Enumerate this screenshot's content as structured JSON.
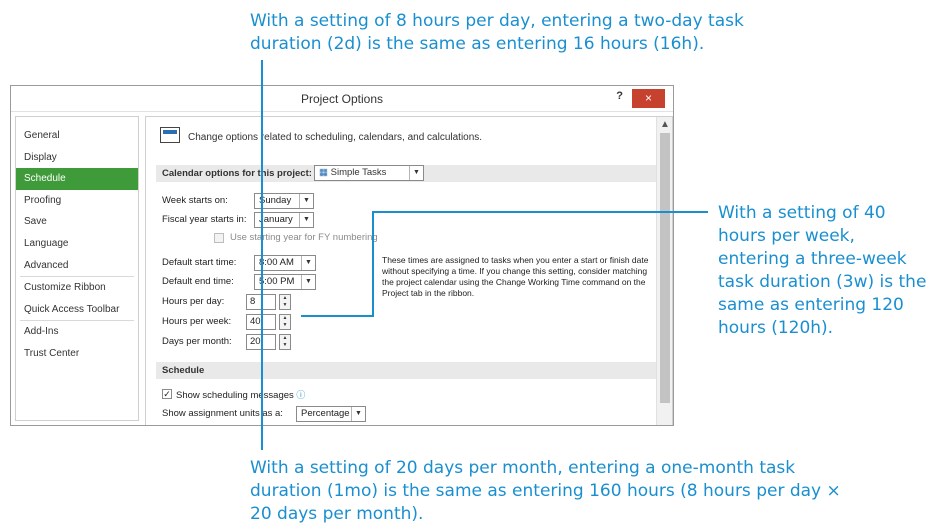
{
  "callouts": {
    "top": "With a setting of 8 hours per day, entering a two-day task duration (2d) is the same as entering 16 hours (16h).",
    "right": "With a setting of 40 hours per week, entering a three-week task duration (3w) is the same as entering 120 hours (120h).",
    "bottom": "With a setting of 20 days per month, entering a one-month task duration (1mo) is the same as entering 160 hours (8 hours per day × 20 days per month).",
    "color": "#1a8fd0"
  },
  "dialog": {
    "title": "Project Options",
    "help": "?",
    "close": "×",
    "nav": [
      "General",
      "Display",
      "Schedule",
      "Proofing",
      "Save",
      "Language",
      "Advanced",
      "Customize Ribbon",
      "Quick Access Toolbar",
      "Add-Ins",
      "Trust Center"
    ],
    "nav_active": "Schedule",
    "header": "Change options related to scheduling, calendars, and calculations.",
    "calendar_section": "Calendar options for this project:",
    "calendar_project": "Simple Tasks",
    "week_starts_label": "Week starts on:",
    "week_starts_value": "Sunday",
    "fiscal_label": "Fiscal year starts in:",
    "fiscal_value": "January",
    "fy_numbering": "Use starting year for FY numbering",
    "start_time_label": "Default start time:",
    "start_time_value": "8:00 AM",
    "end_time_label": "Default end time:",
    "end_time_value": "5:00 PM",
    "hours_day_label": "Hours per day:",
    "hours_day_value": "8",
    "hours_week_label": "Hours per week:",
    "hours_week_value": "40",
    "days_month_label": "Days per month:",
    "days_month_value": "20",
    "times_note": "These times are assigned to tasks when you enter a start or finish date without specifying a time. If you change this setting, consider matching the project calendar using the Change Working Time command on the Project tab in the ribbon.",
    "schedule_section": "Schedule",
    "show_messages": "Show scheduling messages",
    "assignment_units_label": "Show assignment units as a:",
    "assignment_units_value": "Percentage",
    "accent": "#3f9a3a"
  }
}
